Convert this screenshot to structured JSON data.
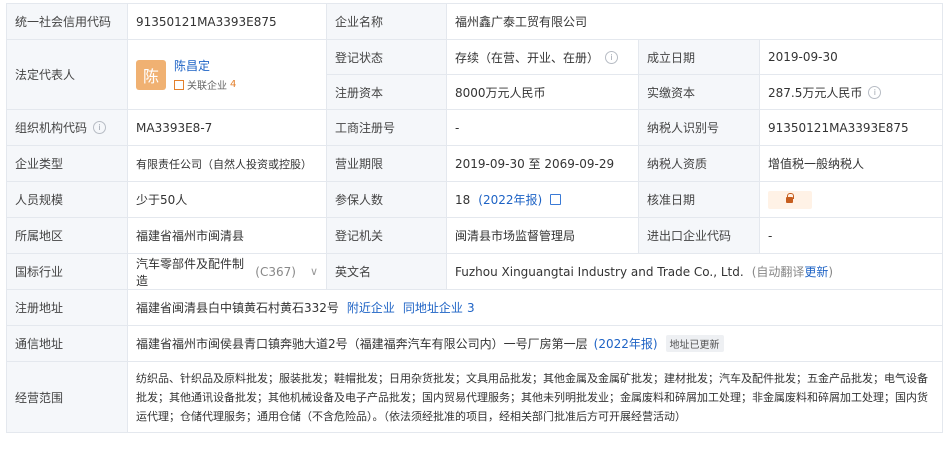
{
  "rows": {
    "credit_code": {
      "label": "统一社会信用代码",
      "value": "91350121MA3393E875"
    },
    "company_name": {
      "label": "企业名称",
      "value": "福州鑫广泰工贸有限公司"
    },
    "legal_rep": {
      "label": "法定代表人",
      "avatar_char": "陈",
      "name": "陈昌定",
      "related_label": "关联企业",
      "related_count": "4"
    },
    "reg_status": {
      "label": "登记状态",
      "value": "存续（在营、开业、在册）"
    },
    "founded": {
      "label": "成立日期",
      "value": "2019-09-30"
    },
    "reg_capital": {
      "label": "注册资本",
      "value": "8000万元人民币"
    },
    "paid_capital": {
      "label": "实缴资本",
      "value": "287.5万元人民币"
    },
    "org_code": {
      "label": "组织机构代码",
      "value": "MA3393E8-7"
    },
    "biz_reg_no": {
      "label": "工商注册号",
      "value": "-"
    },
    "taxpayer_id": {
      "label": "纳税人识别号",
      "value": "91350121MA3393E875"
    },
    "company_type": {
      "label": "企业类型",
      "value": "有限责任公司（自然人投资或控股）"
    },
    "biz_term": {
      "label": "营业期限",
      "value": "2019-09-30 至 2069-09-29"
    },
    "taxpayer_qual": {
      "label": "纳税人资质",
      "value": "增值税一般纳税人"
    },
    "staff_size": {
      "label": "人员规模",
      "value": "少于50人"
    },
    "insured": {
      "label": "参保人数",
      "value": "18",
      "report": "(2022年报)"
    },
    "approval_date": {
      "label": "核准日期"
    },
    "region": {
      "label": "所属地区",
      "value": "福建省福州市闽清县"
    },
    "reg_authority": {
      "label": "登记机关",
      "value": "闽清县市场监督管理局"
    },
    "import_export": {
      "label": "进出口企业代码",
      "value": "-"
    },
    "industry": {
      "label": "国标行业",
      "value": "汽车零部件及配件制造",
      "code": "(C367)"
    },
    "english_name": {
      "label": "英文名",
      "value": "Fuzhou Xinguangtai Industry and Trade Co., Ltd.",
      "note_prefix": "(自动翻译",
      "note_link": "更新",
      "note_suffix": ")"
    },
    "reg_address": {
      "label": "注册地址",
      "value": "福建省闽清县白中镇黄石村黄石332号",
      "nearby": "附近企业",
      "same_addr": "同地址企业",
      "same_count": "3"
    },
    "mail_address": {
      "label": "通信地址",
      "value": "福建省福州市闽侯县青口镇奔驰大道2号（福建福奔汽车有限公司内）一号厂房第一层",
      "report": "(2022年报)",
      "tag": "地址已更新"
    },
    "biz_scope": {
      "label": "经营范围",
      "value": "纺织品、针织品及原料批发；服装批发；鞋帽批发；日用杂货批发；文具用品批发；其他金属及金属矿批发；建材批发；汽车及配件批发；五金产品批发；电气设备批发；其他通讯设备批发；其他机械设备及电子产品批发；国内贸易代理服务；其他未列明批发业；金属废料和碎屑加工处理；非金属废料和碎屑加工处理；国内货运代理；仓储代理服务；通用仓储（不含危险品）。（依法须经批准的项目，经相关部门批准后方可开展经营活动）"
    }
  },
  "colors": {
    "label_bg": "#f5f7fa",
    "border": "#e4e8ee",
    "link": "#1e63c5",
    "avatar": "#f0b172"
  }
}
